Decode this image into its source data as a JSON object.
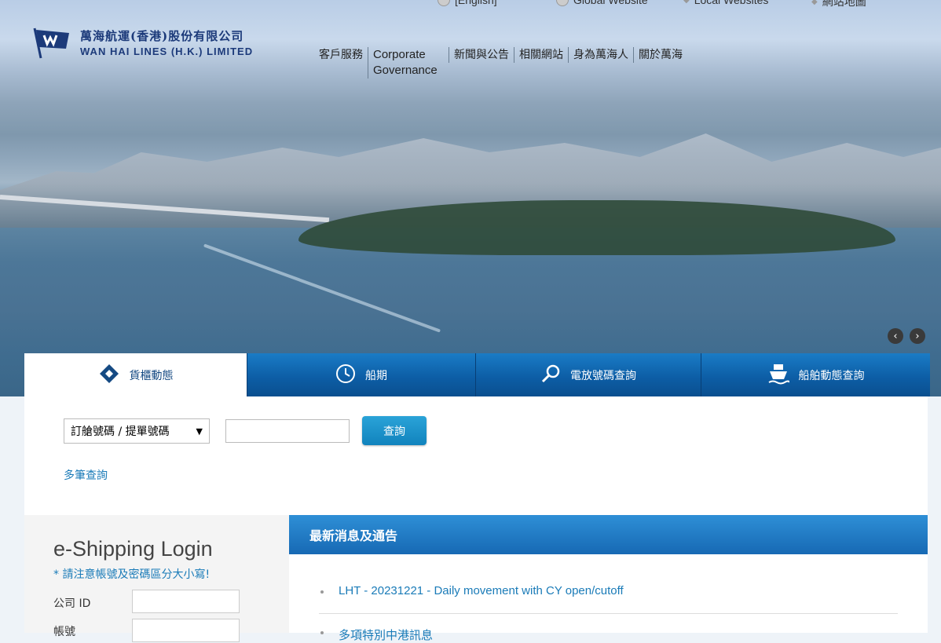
{
  "header": {
    "company_cn": "萬海航運(香港)股份有限公司",
    "company_en": "WAN HAI LINES (H.K.) LIMITED",
    "top_links": [
      {
        "label": "[English]",
        "icon": "globe-icon"
      },
      {
        "label": "Global Website",
        "icon": "globe-icon"
      },
      {
        "label": "Local Websites",
        "icon": "pin-icon"
      },
      {
        "label": "網站地圖",
        "icon": "pin-icon"
      }
    ],
    "nav": [
      "客戶服務",
      "Corporate Governance",
      "新聞與公告",
      "相關網站",
      "身為萬海人",
      "關於萬海"
    ]
  },
  "carousel": {
    "prev": "‹",
    "next": "›"
  },
  "tabs": [
    {
      "label": "貨櫃動態",
      "icon": "container-icon",
      "active": true
    },
    {
      "label": "船期",
      "icon": "clock-icon",
      "active": false
    },
    {
      "label": "電放號碼查詢",
      "icon": "magnifier-icon",
      "active": false
    },
    {
      "label": "船舶動態查詢",
      "icon": "ship-icon",
      "active": false
    }
  ],
  "query": {
    "select_value": "訂艙號碼 / 提單號碼",
    "input_value": "",
    "button": "查詢",
    "multi_link": "多筆查詢"
  },
  "login": {
    "title": "e-Shipping Login",
    "note": "* 請注意帳號及密碼區分大小寫!",
    "company_id_label": "公司 ID",
    "account_label": "帳號"
  },
  "news": {
    "title": "最新消息及通告",
    "items": [
      "LHT - 20231221 - Daily movement with CY open/cutoff",
      "多項特別中港訊息"
    ]
  },
  "colors": {
    "brand_blue": "#1c3a7a",
    "tab_blue": "#0d5ea6",
    "link_blue": "#1a7bb8"
  }
}
